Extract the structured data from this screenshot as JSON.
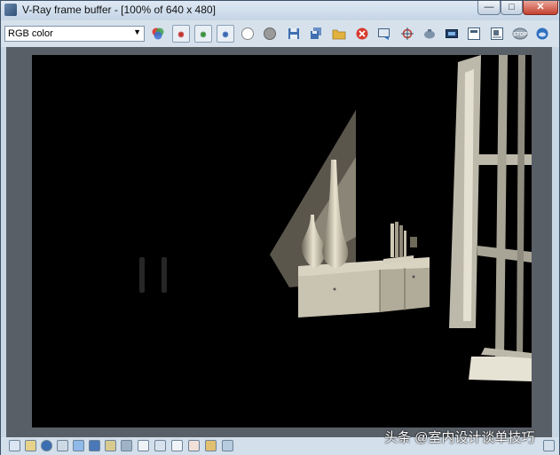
{
  "window": {
    "title": "V-Ray frame buffer - [100% of 640 x 480]"
  },
  "toolbar": {
    "channel_value": "RGB color"
  },
  "status_icons": [
    "sb-1",
    "sb-2",
    "sb-3",
    "sb-4",
    "sb-5",
    "sb-6",
    "sb-7",
    "sb-8",
    "sb-9",
    "sb-10",
    "sb-11",
    "sb-12",
    "sb-13",
    "sb-14",
    "sb-15",
    "sb-16",
    "sb-17"
  ],
  "watermark": {
    "text": "头条 @室内设计谈单技巧"
  },
  "colors": {
    "accent_blue": "#3a6ea5",
    "close_red": "#c4412f"
  }
}
